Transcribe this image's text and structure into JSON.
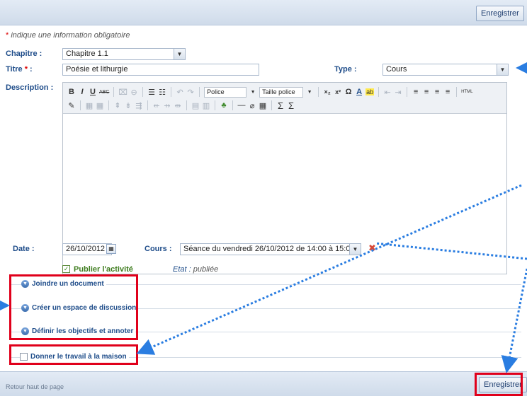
{
  "header": {
    "save_label": "Enregistrer"
  },
  "notice": {
    "asterisk": "*",
    "text": " indique une information obligatoire"
  },
  "form": {
    "chapitre": {
      "label": "Chapitre :",
      "value": "Chapitre 1.1"
    },
    "titre": {
      "label": "Titre",
      "asterisk": "*",
      "colon": " :",
      "value": "Poésie et lithurgie"
    },
    "type": {
      "label": "Type :",
      "value": "Cours"
    },
    "description": {
      "label": "Description :"
    },
    "date": {
      "label": "Date :",
      "value": "26/10/2012"
    },
    "cours": {
      "label": "Cours :",
      "value": "Séance du vendredi 26/10/2012 de 14:00 à 15:0("
    },
    "publier": {
      "label": "Publier l'activité",
      "checked": true
    },
    "etat": {
      "label": "Etat :",
      "value": "publiée"
    }
  },
  "editor": {
    "toolbar_row1": [
      "B",
      "I",
      "U",
      "ABC",
      "⌧",
      "⊖",
      "☰",
      "☷",
      "↶",
      "↷"
    ],
    "font_select": "Police",
    "size_select": "Taille police",
    "toolbar_row1b": [
      "×₂",
      "x²",
      "Ω",
      "A",
      "ab",
      "⇤",
      "⇥",
      "≡",
      "≡",
      "≡",
      "≡",
      "HTML"
    ],
    "toolbar_row2": [
      "✎",
      "▦",
      "▦",
      "⇞",
      "⇟",
      "⇶",
      "⇷",
      "⇸",
      "⇹",
      "▤",
      "▥",
      "♣",
      "—",
      "⌀",
      "▦",
      "Σ",
      "Σ"
    ]
  },
  "sections": {
    "joindre": "Joindre un document",
    "discussion": "Créer un espace de discussion",
    "objectifs": "Définir les objectifs et annoter",
    "travail": "Donner le travail à la maison"
  },
  "footer": {
    "back_top": "Retour haut de page",
    "save_label": "Enregistrer"
  },
  "colors": {
    "highlight": "#e0001b",
    "arrow": "#2a7de1",
    "accent": "#1f4d8a"
  }
}
